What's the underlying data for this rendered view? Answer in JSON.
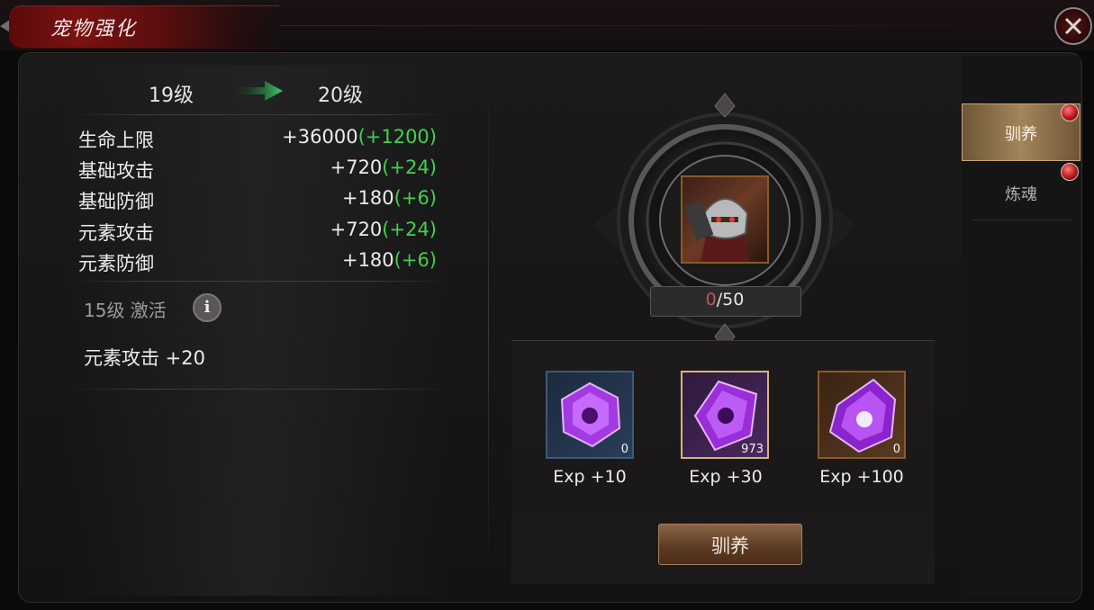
{
  "title": "宠物强化",
  "level": {
    "from": "19级",
    "to": "20级"
  },
  "stats": [
    {
      "label": "生命上限",
      "value": "+36000",
      "bonus": "(+1200)"
    },
    {
      "label": "基础攻击",
      "value": "+720",
      "bonus": "(+24)"
    },
    {
      "label": "基础防御",
      "value": "+180",
      "bonus": "(+6)"
    },
    {
      "label": "元素攻击",
      "value": "+720",
      "bonus": "(+24)"
    },
    {
      "label": "元素防御",
      "value": "+180",
      "bonus": "(+6)"
    }
  ],
  "unlock": {
    "label": "15级 激活",
    "info_icon": "i",
    "bonus": "元素攻击 +20"
  },
  "progress": {
    "current": "0",
    "max": "/50"
  },
  "items": [
    {
      "count": "0",
      "exp": "Exp +10",
      "icon": "purple-gem-small-icon"
    },
    {
      "count": "973",
      "exp": "Exp +30",
      "icon": "purple-gem-medium-icon"
    },
    {
      "count": "0",
      "exp": "Exp +100",
      "icon": "purple-gem-large-icon"
    }
  ],
  "train_button": "驯养",
  "tabs": [
    {
      "label": "驯养"
    },
    {
      "label": "炼魂"
    }
  ],
  "colors": {
    "bonus_green": "#3fd24b",
    "title_red": "#7a1212",
    "tab_gold": "#a3855a",
    "progress_current": "#c2555a"
  }
}
